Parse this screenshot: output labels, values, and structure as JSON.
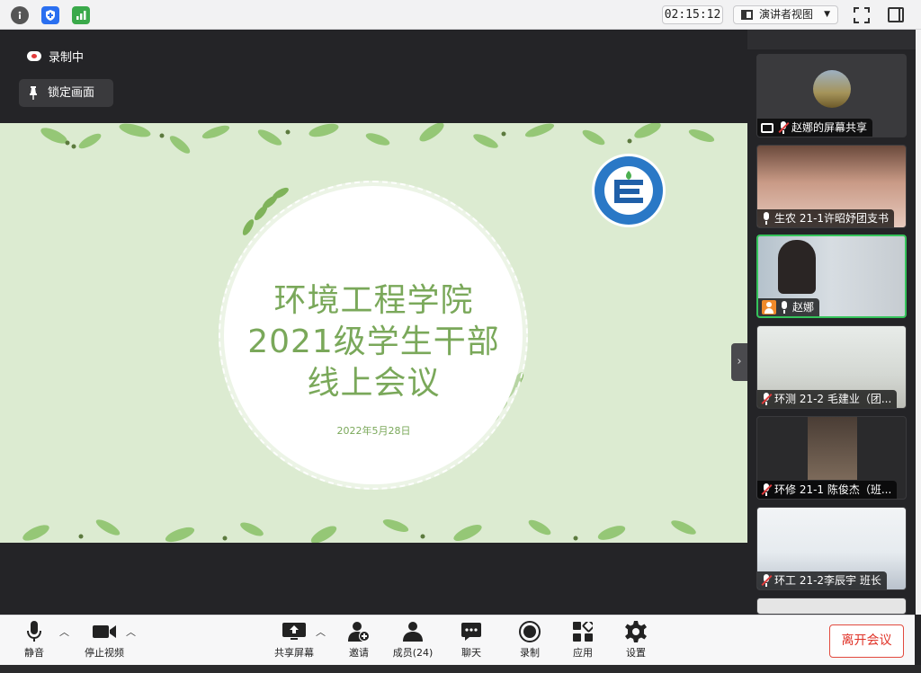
{
  "topbar": {
    "icons": [
      "info-icon",
      "shield-icon",
      "signal-icon"
    ],
    "timer": "02:15:12",
    "view_label": "演讲者视图",
    "view_caret": "▼"
  },
  "share": {
    "recording_label": "录制中",
    "lock_label": "锁定画面"
  },
  "slide": {
    "title_line1": "环境工程学院",
    "title_line2": "2021级学生干部",
    "title_line3": "线上会议",
    "date": "2022年5月28日"
  },
  "gallery": {
    "tiles": [
      {
        "name": "赵娜的屏幕共享",
        "mic": "muted",
        "icon": "share"
      },
      {
        "name": "生农 21-1许昭妤团支书",
        "mic": "on"
      },
      {
        "name": "赵娜",
        "mic": "on",
        "active": true
      },
      {
        "name": "环测 21-2 毛建业（团...",
        "mic": "muted"
      },
      {
        "name": "环修 21-1 陈俊杰（班...",
        "mic": "muted"
      },
      {
        "name": "环工 21-2李辰宇 班长",
        "mic": "muted"
      }
    ]
  },
  "toolbar": {
    "mute": "静音",
    "stop_video": "停止视频",
    "share_screen": "共享屏幕",
    "invite": "邀请",
    "members": "成员(24)",
    "chat": "聊天",
    "record": "录制",
    "apps": "应用",
    "settings": "设置",
    "leave": "离开会议"
  },
  "colors": {
    "slide_green": "#7aa85a",
    "active_border": "#35c45b",
    "leave_red": "#e03328",
    "rec_dot": "#e23b3b"
  }
}
